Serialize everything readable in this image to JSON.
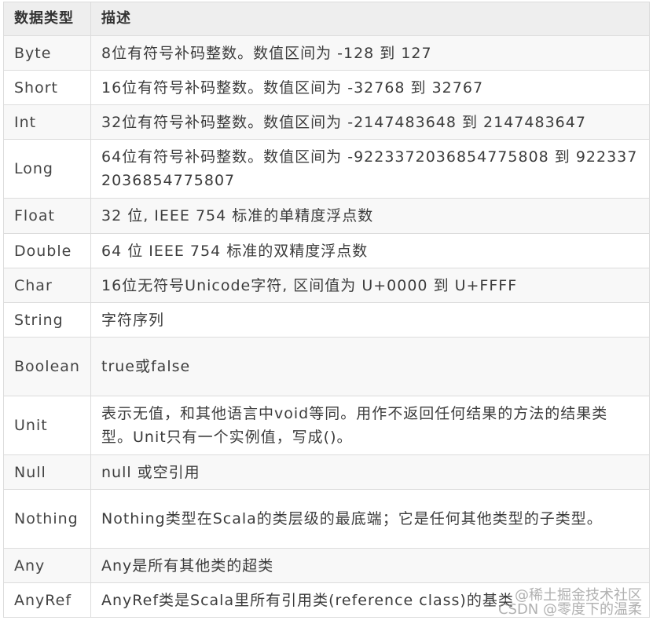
{
  "table": {
    "headers": [
      "数据类型",
      "描述"
    ],
    "rows": [
      {
        "type": "Byte",
        "desc": "8位有符号补码整数。数值区间为 -128 到 127"
      },
      {
        "type": "Short",
        "desc": "16位有符号补码整数。数值区间为 -32768 到 32767"
      },
      {
        "type": "Int",
        "desc": "32位有符号补码整数。数值区间为 -2147483648 到 2147483647"
      },
      {
        "type": "Long",
        "desc": "64位有符号补码整数。数值区间为 -9223372036854775808 到 9223372036854775807"
      },
      {
        "type": "Float",
        "desc": "32 位, IEEE 754 标准的单精度浮点数"
      },
      {
        "type": "Double",
        "desc": "64 位 IEEE 754 标准的双精度浮点数"
      },
      {
        "type": "Char",
        "desc": "16位无符号Unicode字符, 区间值为 U+0000 到 U+FFFF"
      },
      {
        "type": "String",
        "desc": "字符序列"
      },
      {
        "type": "Boolean",
        "desc": "true或false"
      },
      {
        "type": "Unit",
        "desc": "表示无值，和其他语言中void等同。用作不返回任何结果的方法的结果类型。Unit只有一个实例值，写成()。"
      },
      {
        "type": "Null",
        "desc": "null 或空引用"
      },
      {
        "type": "Nothing",
        "desc": "Nothing类型在Scala的类层级的最底端；它是任何其他类型的子类型。"
      },
      {
        "type": "Any",
        "desc": "Any是所有其他类的超类"
      },
      {
        "type": "AnyRef",
        "desc": "AnyRef类是Scala里所有引用类(reference class)的基类"
      }
    ]
  },
  "watermark": {
    "line1": "@稀土掘金技术社区",
    "line2": "CSDN @零度下的温柔"
  }
}
